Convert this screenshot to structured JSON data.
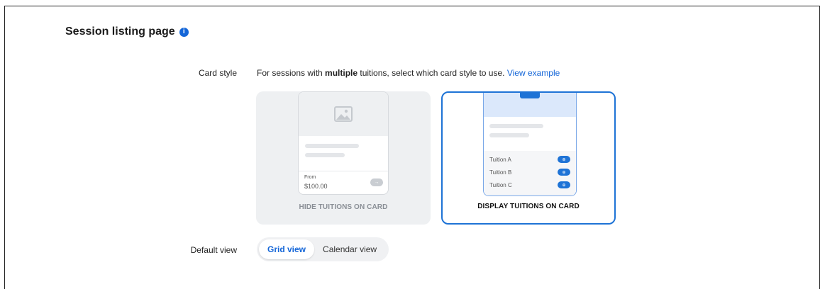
{
  "section": {
    "title": "Session listing page",
    "info_icon": "info-icon"
  },
  "card_style": {
    "label": "Card style",
    "desc_prefix": "For sessions with ",
    "desc_bold": "multiple",
    "desc_suffix": " tuitions, select which card style to use. ",
    "view_example_link": "View example",
    "options": {
      "hide": {
        "caption": "HIDE TUITIONS ON CARD",
        "from_label": "From",
        "price": "$100.00",
        "selected": false
      },
      "display": {
        "caption": "DISPLAY TUITIONS ON CARD",
        "selected": true,
        "tuitions": [
          "Tuition A",
          "Tuition B",
          "Tuition C"
        ]
      }
    }
  },
  "default_view": {
    "label": "Default view",
    "options": [
      "Grid view",
      "Calendar view"
    ],
    "selected": "Grid view"
  },
  "colors": {
    "accent": "#1466d8",
    "selected_border": "#1e73d6"
  }
}
